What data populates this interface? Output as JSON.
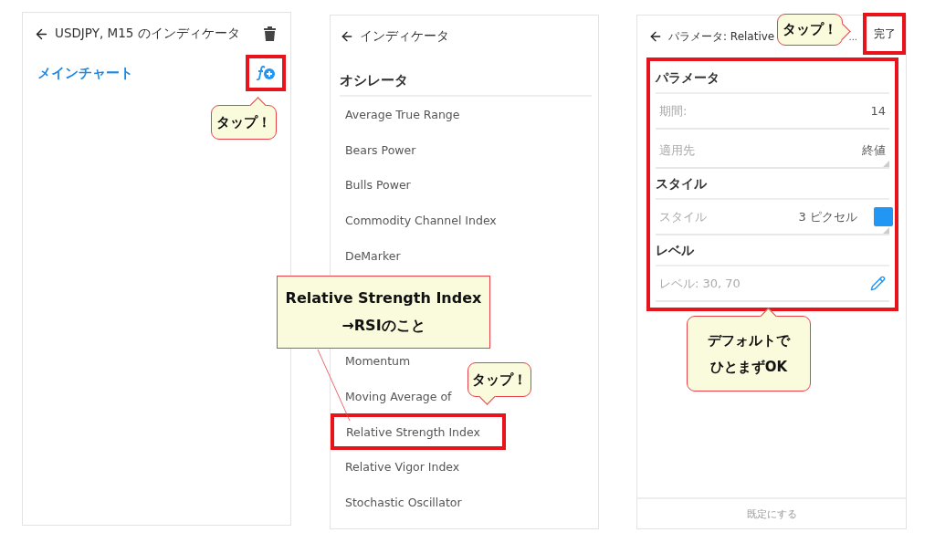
{
  "chart_indicators": {
    "title": "USDJPY, M15 のインディケータ",
    "main_chart": "メインチャート",
    "add_button": {
      "highlighted": true
    }
  },
  "indicator_list": {
    "title": "インディケータ",
    "section": "オシレータ",
    "items_upper": [
      {
        "label": "Average True Range",
        "highlighted": false
      },
      {
        "label": "Bears Power",
        "highlighted": false
      },
      {
        "label": "Bulls Power",
        "highlighted": false
      },
      {
        "label": "Commodity Channel Index",
        "highlighted": false
      },
      {
        "label": "DeMarker",
        "highlighted": false
      }
    ],
    "items_lower": [
      {
        "label": "Momentum",
        "highlighted": false
      },
      {
        "label": "Moving Average of",
        "highlighted": false
      },
      {
        "label": "Relative Strength Index",
        "highlighted": true
      },
      {
        "label": "Relative Vigor Index",
        "highlighted": false
      },
      {
        "label": "Stochastic Oscillator",
        "highlighted": false
      }
    ]
  },
  "parameters": {
    "title": "パラメータ: Relative",
    "ellipsis": "...",
    "done": {
      "label": "完了",
      "highlighted": true
    },
    "highlighted": true,
    "sections": [
      {
        "heading": "パラメータ",
        "fields": [
          {
            "kind": "number",
            "label": "期間:",
            "value": "14"
          },
          {
            "kind": "select",
            "label": "適用先",
            "value": "終値"
          }
        ]
      },
      {
        "heading": "スタイル",
        "fields": [
          {
            "kind": "style",
            "label": "スタイル",
            "value": "3 ピクセル",
            "color": "#2196f3"
          }
        ]
      },
      {
        "heading": "レベル",
        "fields": [
          {
            "kind": "edit",
            "label": "レベル:",
            "value": "30, 70"
          }
        ]
      }
    ],
    "footer": "既定にする"
  },
  "callouts": [
    {
      "kind": "rounded",
      "lines": [
        "タップ！"
      ]
    },
    {
      "kind": "square",
      "lines": [
        "Relative Strength Index",
        "→RSIのこと"
      ]
    },
    {
      "kind": "rounded",
      "lines": [
        "タップ！"
      ]
    },
    {
      "kind": "rounded",
      "lines": [
        "タップ！"
      ]
    },
    {
      "kind": "rounded",
      "lines": [
        "デフォルトで",
        "ひとまずOK"
      ]
    }
  ]
}
